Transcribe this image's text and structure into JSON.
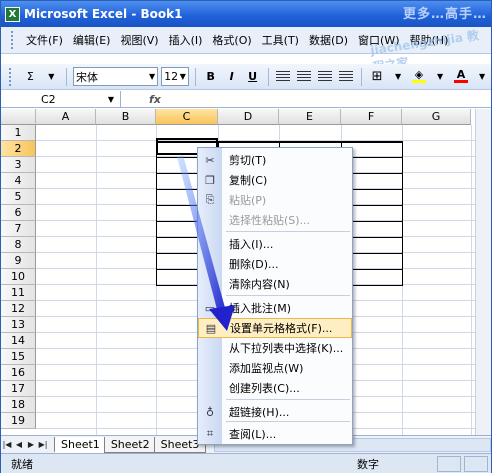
{
  "window": {
    "title": "Microsoft Excel - Book1",
    "app_icon": "X"
  },
  "watermark": {
    "top": "更多…高手…",
    "mid": "jiachengzhijia 教程之家"
  },
  "menu": [
    {
      "label": "文件(F)"
    },
    {
      "label": "编辑(E)"
    },
    {
      "label": "视图(V)"
    },
    {
      "label": "插入(I)"
    },
    {
      "label": "格式(O)"
    },
    {
      "label": "工具(T)"
    },
    {
      "label": "数据(D)"
    },
    {
      "label": "窗口(W)"
    },
    {
      "label": "帮助(H)"
    }
  ],
  "toolbar": {
    "sum": "Σ",
    "font_name": "宋体",
    "font_size": "12",
    "bold": "B",
    "italic": "I",
    "underline": "U",
    "fill_color": "#ffff00",
    "font_color": "#ff0000"
  },
  "formula_bar": {
    "name_box": "C2",
    "fx": "fx"
  },
  "grid": {
    "columns": [
      "A",
      "B",
      "C",
      "D",
      "E",
      "F",
      "G"
    ],
    "rows": [
      "1",
      "2",
      "3",
      "4",
      "5",
      "6",
      "7",
      "8",
      "9",
      "10",
      "11",
      "12",
      "13",
      "14",
      "15",
      "16",
      "17",
      "18",
      "19"
    ],
    "selected_column": "C",
    "selected_row": "2"
  },
  "context_menu": {
    "items": [
      {
        "label": "剪切(T)",
        "icon": "scissors-icon",
        "glyph": "✂",
        "enabled": true
      },
      {
        "label": "复制(C)",
        "icon": "copy-icon",
        "glyph": "❐",
        "enabled": true
      },
      {
        "label": "粘贴(P)",
        "icon": "paste-icon",
        "glyph": "⎘",
        "enabled": false
      },
      {
        "label": "选择性粘贴(S)...",
        "icon": "",
        "glyph": "",
        "enabled": false
      },
      {
        "label": "插入(I)...",
        "icon": "",
        "glyph": "",
        "enabled": true
      },
      {
        "label": "删除(D)...",
        "icon": "",
        "glyph": "",
        "enabled": true
      },
      {
        "label": "清除内容(N)",
        "icon": "",
        "glyph": "",
        "enabled": true
      },
      {
        "label": "插入批注(M)",
        "icon": "comment-icon",
        "glyph": "▭",
        "enabled": true
      },
      {
        "label": "设置单元格格式(F)...",
        "icon": "format-cells-icon",
        "glyph": "▤",
        "enabled": true,
        "highlighted": true
      },
      {
        "label": "从下拉列表中选择(K)...",
        "icon": "",
        "glyph": "",
        "enabled": true
      },
      {
        "label": "添加监视点(W)",
        "icon": "",
        "glyph": "",
        "enabled": true
      },
      {
        "label": "创建列表(C)...",
        "icon": "",
        "glyph": "",
        "enabled": true
      },
      {
        "label": "超链接(H)...",
        "icon": "hyperlink-icon",
        "glyph": "♁",
        "enabled": true
      },
      {
        "label": "查阅(L)...",
        "icon": "lookup-icon",
        "glyph": "⌗",
        "enabled": true
      }
    ]
  },
  "sheets": [
    {
      "label": "Sheet1",
      "active": true
    },
    {
      "label": "Sheet2"
    },
    {
      "label": "Sheet3"
    }
  ],
  "status": {
    "left": "就绪",
    "mid": "数字"
  },
  "colors": {
    "title_bar": "#1f5fd8",
    "highlight": "#ffeec2",
    "arrow": "#2a2ad0"
  }
}
